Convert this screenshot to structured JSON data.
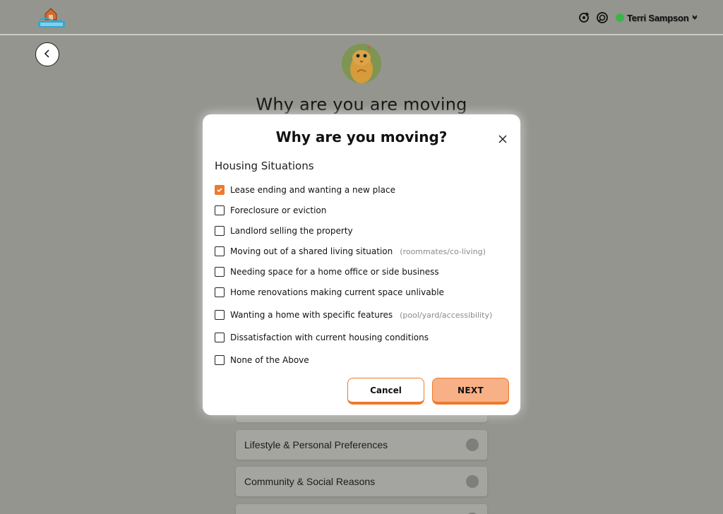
{
  "header": {
    "user_name": "Terri Sampson",
    "icons": [
      "refresh-icon",
      "support-icon",
      "user-status-icon",
      "chevron-down-icon"
    ]
  },
  "page": {
    "heading": "Why are you are moving",
    "categories": [
      {
        "label": ""
      },
      {
        "label": "Lifestyle & Personal Preferences"
      },
      {
        "label": "Community & Social Reasons"
      },
      {
        "label": ""
      }
    ]
  },
  "modal": {
    "title": "Why are you moving?",
    "section_title": "Housing Situations",
    "options": [
      {
        "label": "Lease ending and wanting a new place",
        "hint": "",
        "checked": true
      },
      {
        "label": "Foreclosure or eviction",
        "hint": "",
        "checked": false
      },
      {
        "label": "Landlord selling the property",
        "hint": "",
        "checked": false
      },
      {
        "label": "Moving out of a shared living situation",
        "hint": "(roommates/co-living)",
        "checked": false
      },
      {
        "label": "Needing space for a home office or side business",
        "hint": "",
        "checked": false
      },
      {
        "label": "Home renovations making current space unlivable",
        "hint": "",
        "checked": false
      },
      {
        "label": " Wanting a home with specific features",
        "hint": "(pool/yard/accessibility)",
        "checked": false
      },
      {
        "label": "Dissatisfaction with current housing conditions",
        "hint": "",
        "checked": false
      },
      {
        "label": "None of the Above",
        "hint": "",
        "checked": false
      }
    ],
    "cancel_label": "Cancel",
    "next_label": "NEXT"
  },
  "colors": {
    "accent": "#ee7a2b",
    "next_bg": "#f8b186",
    "overlay_bg": "#94958f",
    "status_green": "#39b54a"
  }
}
